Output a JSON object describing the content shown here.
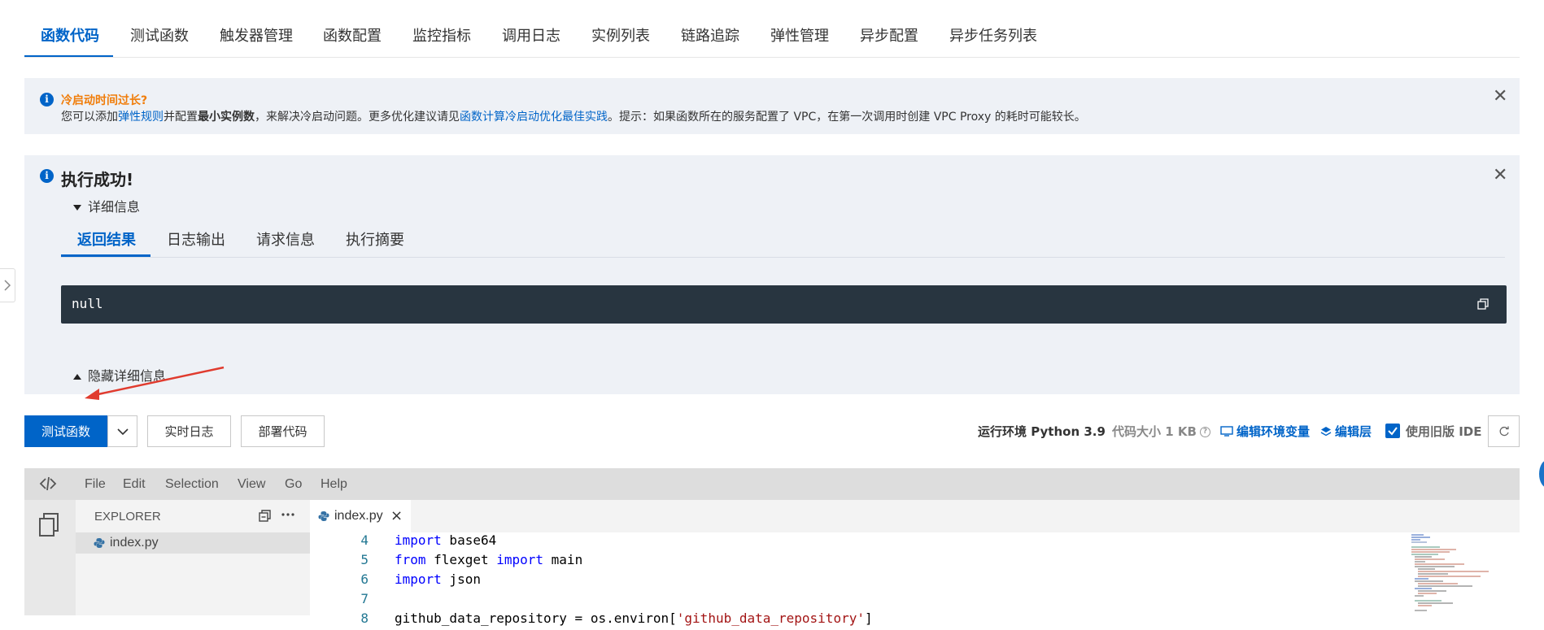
{
  "top_tabs": [
    "函数代码",
    "测试函数",
    "触发器管理",
    "函数配置",
    "监控指标",
    "调用日志",
    "实例列表",
    "链路追踪",
    "弹性管理",
    "异步配置",
    "异步任务列表"
  ],
  "notice": {
    "title": "冷启动时间过长?",
    "text_1": "您可以添加",
    "link_1": "弹性规则",
    "text_2": "并配置",
    "bold_1": "最小实例数",
    "text_3": "，来解决冷启动问题。更多优化建议请见",
    "link_2": "函数计算冷启动优化最佳实践",
    "text_4": "。提示：如果函数所在的服务配置了 VPC，在第一次调用时创建 VPC Proxy 的耗时可能较长。",
    "close": "✕"
  },
  "result": {
    "title": "执行成功!",
    "details_toggle": "详细信息",
    "tabs": [
      "返回结果",
      "日志输出",
      "请求信息",
      "执行摘要"
    ],
    "output": "null",
    "hide_details": "隐藏详细信息",
    "close": "✕"
  },
  "toolbar": {
    "test_button": "测试函数",
    "realtime_log": "实时日志",
    "deploy_code": "部署代码",
    "runtime_label": "运行环境",
    "runtime_value": "Python 3.9",
    "code_size_label": "代码大小",
    "code_size_value": "1 KB",
    "help_mark": "?",
    "edit_env": "编辑环境变量",
    "edit_layer": "编辑层",
    "use_old_ide": "使用旧版 IDE",
    "use_old_ide_checked": true
  },
  "ide": {
    "menu": [
      "File",
      "Edit",
      "Selection",
      "View",
      "Go",
      "Help"
    ],
    "explorer_title": "EXPLORER",
    "file": "index.py",
    "tab": "index.py",
    "tab_close": "×",
    "code_lines": [
      {
        "n": "4",
        "tokens": [
          {
            "t": "import",
            "k": "kw"
          },
          {
            "t": " base64",
            "k": ""
          }
        ]
      },
      {
        "n": "5",
        "tokens": [
          {
            "t": "from",
            "k": "kw"
          },
          {
            "t": " flexget ",
            "k": ""
          },
          {
            "t": "import",
            "k": "kw"
          },
          {
            "t": " main",
            "k": ""
          }
        ]
      },
      {
        "n": "6",
        "tokens": [
          {
            "t": "import",
            "k": "kw"
          },
          {
            "t": " json",
            "k": ""
          }
        ]
      },
      {
        "n": "7",
        "tokens": []
      },
      {
        "n": "8",
        "tokens": [
          {
            "t": "github_data_repository = os.environ[",
            "k": ""
          },
          {
            "t": "'github_data_repository'",
            "k": "str"
          },
          {
            "t": "]",
            "k": ""
          }
        ]
      }
    ]
  }
}
